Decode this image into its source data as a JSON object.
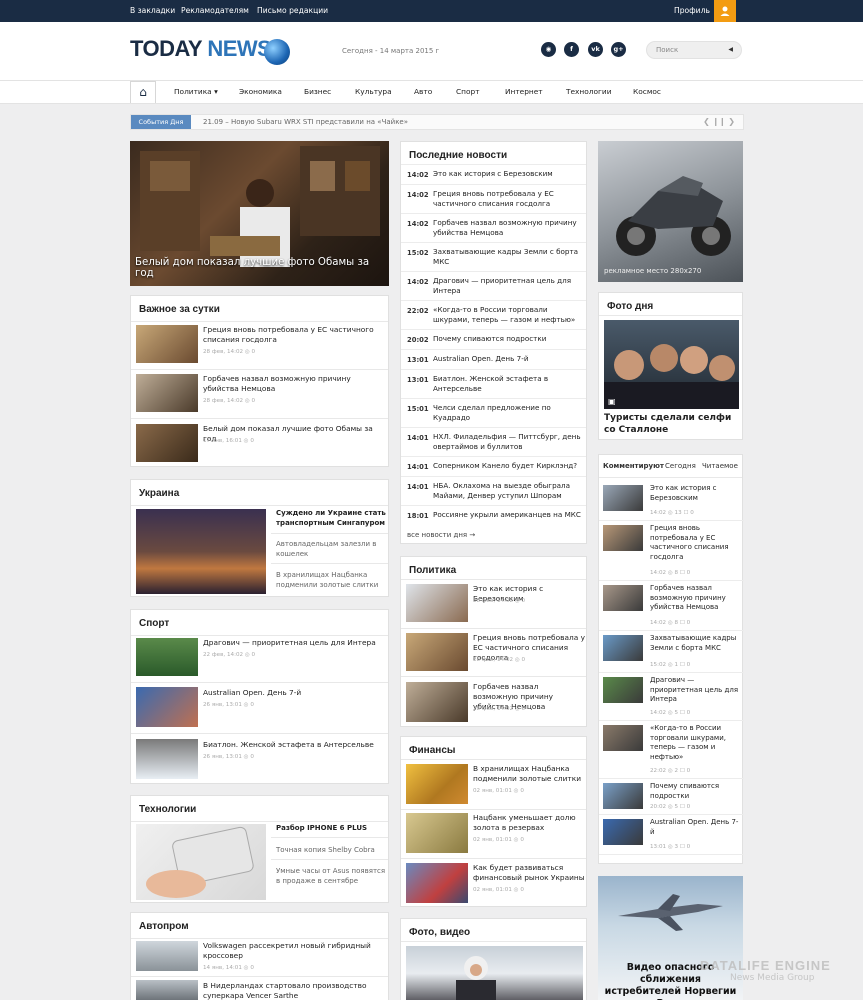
{
  "topbar": {
    "links": [
      "В закладки",
      "Рекламодателям",
      "Письмо редакции"
    ],
    "profile": "Профиль"
  },
  "header": {
    "logo_part1": "TODAY",
    "logo_part2": "NEWS",
    "date": "Сегодня - 14 марта 2015 г",
    "social": [
      "rss-icon",
      "facebook-icon",
      "vk-icon",
      "google-plus-icon"
    ],
    "search_placeholder": "Поиск"
  },
  "nav": {
    "items": [
      "Политика",
      "Экономика",
      "Бизнес",
      "Культура",
      "Авто",
      "Спорт",
      "Интернет",
      "Технологии",
      "Космос"
    ]
  },
  "events": {
    "label": "События Дня",
    "text": "21.09 – Новую Subaru WRX STI представили на «Чайке»"
  },
  "hero": {
    "caption": "Белый дом показал лучшие фото Обамы за год"
  },
  "important": {
    "title": "Важное за сутки",
    "items": [
      {
        "text": "Греция вновь потребовала у ЕС частичного списания госдолга",
        "meta": "28 фев, 14:02  ◎ 0"
      },
      {
        "text": "Горбачев назвал возможную причину убийства Немцова",
        "meta": "28 фев, 14:02  ◎ 0"
      },
      {
        "text": "Белый дом показал лучшие фото Обамы за год",
        "meta": "17 янв, 16:01  ◎ 0"
      }
    ]
  },
  "ukraine": {
    "title": "Украина",
    "items": [
      "Суждено ли Украине стать транспортным Сингапуром",
      "Автовладельцам залезли в кошелек",
      "В хранилищах Нацбанка подменили золотые слитки"
    ]
  },
  "sport": {
    "title": "Спорт",
    "items": [
      {
        "text": "Драгович — приоритетная цель для Интера",
        "meta": "22 фев, 14:02  ◎ 0"
      },
      {
        "text": "Australian Open. День 7-й",
        "meta": "26 янв, 13:01  ◎ 0"
      },
      {
        "text": "Биатлон. Женской эстафета в Антерсельве",
        "meta": "26 янв, 13:01  ◎ 0"
      }
    ]
  },
  "tech": {
    "title": "Технологии",
    "items": [
      "Разбор IPHONE 6 PLUS",
      "Точная копия Shelby Cobra",
      "Умные часы от Asus появятся в продаже в сентябре"
    ]
  },
  "auto": {
    "title": "Автопром",
    "items": [
      {
        "text": "Volkswagen рассекретил новый гибридный кроссовер",
        "meta": "14 янв, 14:01  ◎ 0"
      },
      {
        "text": "В Нидерландах стартовало производство суперкара Vencer Sarthe",
        "meta": ""
      }
    ]
  },
  "latest": {
    "title": "Последние новости",
    "items": [
      {
        "time": "14:02",
        "text": "Это как история с Березовским"
      },
      {
        "time": "14:02",
        "text": "Греция вновь потребовала у ЕС частичного списания госдолга"
      },
      {
        "time": "14:02",
        "text": "Горбачев назвал возможную причину убийства Немцова"
      },
      {
        "time": "15:02",
        "text": "Захватывающие кадры Земли с борта МКС"
      },
      {
        "time": "14:02",
        "text": "Драгович — приоритетная цель для Интера"
      },
      {
        "time": "22:02",
        "text": "«Когда-то в России торговали шкурами, теперь — газом и нефтью»"
      },
      {
        "time": "20:02",
        "text": "Почему спиваются подростки"
      },
      {
        "time": "13:01",
        "text": "Australian Open. День 7-й"
      },
      {
        "time": "13:01",
        "text": "Биатлон. Женской эстафета в Антерсельве"
      },
      {
        "time": "15:01",
        "text": "Челси сделал предложение по Куадрадо"
      },
      {
        "time": "14:01",
        "text": "НХЛ. Филадельфия — Питтсбург, день овертаймов и буллитов"
      },
      {
        "time": "14:01",
        "text": "Соперником Канело будет Кирклэнд?"
      },
      {
        "time": "14:01",
        "text": "НБА. Оклахома на выезде обыграла Майами, Денвер уступил Шпорам"
      },
      {
        "time": "18:01",
        "text": "Россияне укрыли американцев на МКС"
      }
    ],
    "all": "все новости дня →"
  },
  "politics": {
    "title": "Политика",
    "items": [
      {
        "text": "Это как история с Березовским",
        "meta": "28 фев, 14:02  ◎ 0"
      },
      {
        "text": "Греция вновь потребовала у ЕС частичного списания госдолга",
        "meta": "28 фев, 14:02  ◎ 0"
      },
      {
        "text": "Горбачев назвал возможную причину убийства Немцова",
        "meta": "28 фев, 14:02  ◎ 0"
      }
    ]
  },
  "finance": {
    "title": "Финансы",
    "items": [
      {
        "text": "В хранилищах Нацбанка подменили золотые слитки",
        "meta": "02 янв, 01:01  ◎ 0"
      },
      {
        "text": "Нацбанк уменьшает долю золота в резервах",
        "meta": "02 янв, 01:01  ◎ 0"
      },
      {
        "text": "Как будет развиваться финансовый рынок Украины",
        "meta": "02 янв, 01:01  ◎ 0"
      }
    ]
  },
  "photovideo": {
    "title": "Фото, видео"
  },
  "ad": {
    "label": "рекламное место 280x270"
  },
  "photoday": {
    "title": "Фото дня",
    "caption": "Туристы сделали селфи со Сталлоне"
  },
  "tabs": {
    "items": [
      "Комментируют",
      "Сегодня",
      "Читаемое"
    ]
  },
  "comments": {
    "items": [
      {
        "text": "Это как история с Березовским",
        "meta": "14:02  ◎ 13  ☐ 0"
      },
      {
        "text": "Греция вновь потребовала у ЕС частичного списания госдолга",
        "meta": "14:02  ◎ 8  ☐ 0"
      },
      {
        "text": "Горбачев назвал возможную причину убийства Немцова",
        "meta": "14:02  ◎ 8  ☐ 0"
      },
      {
        "text": "Захватывающие кадры Земли с борта МКС",
        "meta": "15:02  ◎ 1  ☐ 0"
      },
      {
        "text": "Драгович — приоритетная цель для Интера",
        "meta": "14:02  ◎ 5  ☐ 0"
      },
      {
        "text": "«Когда-то в России торговали шкурами, теперь — газом и нефтью»",
        "meta": "22:02  ◎ 2  ☐ 0"
      },
      {
        "text": "Почему спиваются подростки",
        "meta": "20:02  ◎ 5  ☐ 0"
      },
      {
        "text": "Australian Open. День 7-й",
        "meta": "13:01  ◎ 3  ☐ 0"
      }
    ]
  },
  "video": {
    "caption": "Видео опасного сближения истребителей Норвегии и России"
  },
  "watermark": {
    "title": "DATALIFE ENGINE",
    "sub": "News Media Group"
  }
}
